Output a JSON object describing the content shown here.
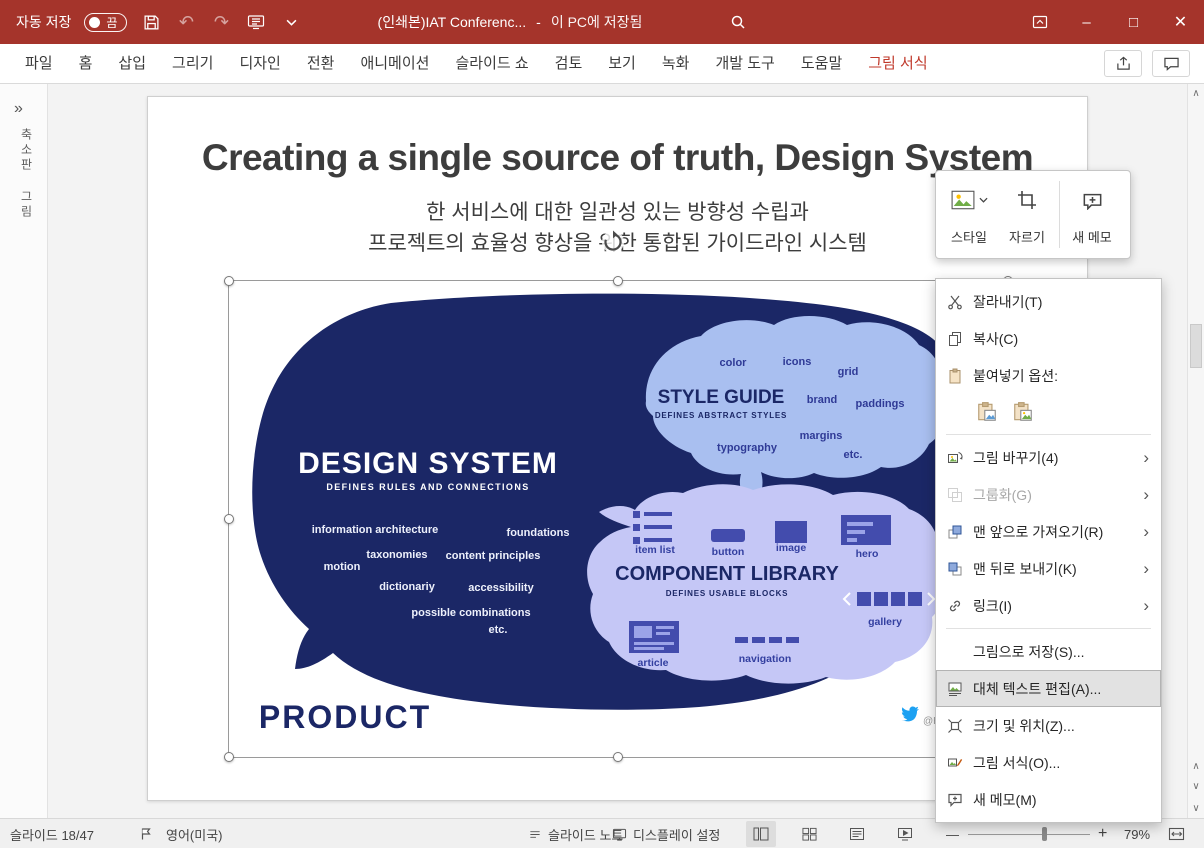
{
  "colors": {
    "titlebar-bg": "#A5342B",
    "tab-active": "#C0392B",
    "whale-navy": "#1B2766",
    "blob-blue": "#A9BFF0",
    "blob-purple": "#C5C7F6",
    "menu-highlight": "#E2E2E2"
  },
  "icons": {
    "minimize": "–",
    "maximize": "□",
    "close": "✕",
    "undo": "↶",
    "redo": "↷",
    "expand_panel": "»",
    "submenu_arrow": "›",
    "scroll_up": "∧",
    "scroll_down": "∨",
    "prev_slide": "∧",
    "next_slide": "∨",
    "zoom_out": "—",
    "zoom_in": "+"
  },
  "titlebar": {
    "autosave_label": "자동 저장",
    "autosave_state": "끔",
    "document_title": "(인쇄본)IAT Conferenc...",
    "separator": "-",
    "saved_status": "이 PC에 저장됨"
  },
  "ribbon": {
    "tabs": [
      {
        "label": "파일"
      },
      {
        "label": "홈"
      },
      {
        "label": "삽입"
      },
      {
        "label": "그리기"
      },
      {
        "label": "디자인"
      },
      {
        "label": "전환"
      },
      {
        "label": "애니메이션"
      },
      {
        "label": "슬라이드 쇼"
      },
      {
        "label": "검토"
      },
      {
        "label": "보기"
      },
      {
        "label": "녹화"
      },
      {
        "label": "개발 도구"
      },
      {
        "label": "도움말"
      },
      {
        "label": "그림 서식"
      }
    ]
  },
  "left_panel": {
    "vertical_label": "축소판 그림"
  },
  "slide": {
    "title": "Creating a single source of truth, Design System",
    "subtitle_line1": "한 서비스에 대한 일관성 있는 방향성 수립과",
    "subtitle_line2": "프로젝트의 효율성 향상을 위한 통합된 가이드라인 시스템",
    "diagram": {
      "design_system": {
        "title": "DESIGN SYSTEM",
        "subtitle": "DEFINES RULES AND CONNECTIONS",
        "items": [
          "information architecture",
          "foundations",
          "taxonomies",
          "content principles",
          "motion",
          "dictionariy",
          "accessibility",
          "possible combinations",
          "etc."
        ]
      },
      "style_guide": {
        "title": "STYLE GUIDE",
        "subtitle": "DEFINES ABSTRACT STYLES",
        "items": [
          "color",
          "icons",
          "grid",
          "brand",
          "paddings",
          "margins",
          "typography",
          "etc."
        ]
      },
      "component_library": {
        "title": "COMPONENT LIBRARY",
        "subtitle": "DEFINES USABLE BLOCKS",
        "items": [
          "item list",
          "button",
          "image",
          "hero",
          "gallery",
          "article",
          "navigation"
        ]
      },
      "product_label": "PRODUCT",
      "credit": "@Honza"
    }
  },
  "mini_toolbar": {
    "style_label": "스타일",
    "crop_label": "자르기",
    "new_comment_label": "새 메모"
  },
  "context_menu": {
    "cut": "잘라내기(T)",
    "copy": "복사(C)",
    "paste_options": "붙여넣기 옵션:",
    "change_picture": "그림 바꾸기(4)",
    "group": "그룹화(G)",
    "bring_to_front": "맨 앞으로 가져오기(R)",
    "send_to_back": "맨 뒤로 보내기(K)",
    "link": "링크(I)",
    "save_as_picture": "그림으로 저장(S)...",
    "edit_alt_text": "대체 텍스트 편집(A)...",
    "size_and_position": "크기 및 위치(Z)...",
    "format_picture": "그림 서식(O)...",
    "new_comment": "새 메모(M)"
  },
  "status_bar": {
    "slide_counter": "슬라이드 18/47",
    "language": "영어(미국)",
    "notes_label": "슬라이드 노트",
    "display_settings_label": "디스플레이 설정",
    "zoom_level": "79%"
  }
}
